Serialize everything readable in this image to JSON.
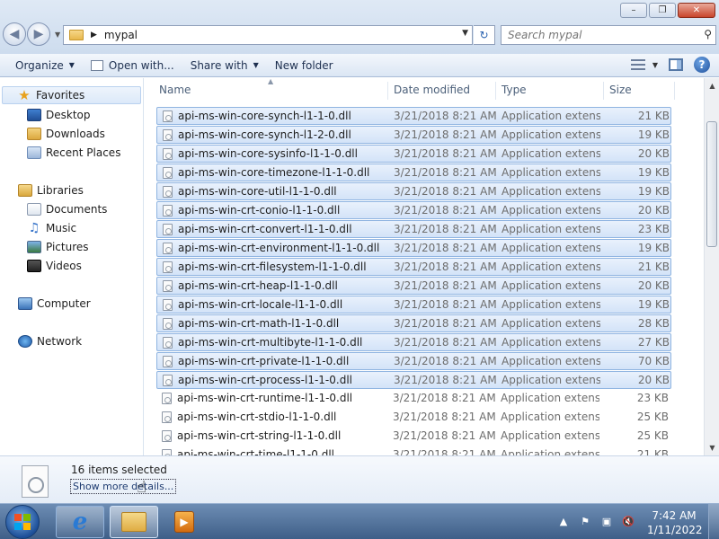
{
  "window": {
    "controls": {
      "minimize": "–",
      "maximize": "❐",
      "close": "✕"
    }
  },
  "address": {
    "path": "mypal",
    "search_placeholder": "Search mypal"
  },
  "toolbar": {
    "organize": "Organize",
    "open_with": "Open with...",
    "share_with": "Share with",
    "new_folder": "New folder"
  },
  "navpane": {
    "favorites": "Favorites",
    "desktop": "Desktop",
    "downloads": "Downloads",
    "recent_places": "Recent Places",
    "libraries": "Libraries",
    "documents": "Documents",
    "music": "Music",
    "pictures": "Pictures",
    "videos": "Videos",
    "computer": "Computer",
    "network": "Network"
  },
  "columns": {
    "name": "Name",
    "date": "Date modified",
    "type": "Type",
    "size": "Size"
  },
  "files": [
    {
      "name": "api-ms-win-core-synch-l1-1-0.dll",
      "date": "3/21/2018 8:21 AM",
      "type": "Application extens...",
      "size": "21 KB",
      "selected": true
    },
    {
      "name": "api-ms-win-core-synch-l1-2-0.dll",
      "date": "3/21/2018 8:21 AM",
      "type": "Application extens...",
      "size": "19 KB",
      "selected": true
    },
    {
      "name": "api-ms-win-core-sysinfo-l1-1-0.dll",
      "date": "3/21/2018 8:21 AM",
      "type": "Application extens...",
      "size": "20 KB",
      "selected": true
    },
    {
      "name": "api-ms-win-core-timezone-l1-1-0.dll",
      "date": "3/21/2018 8:21 AM",
      "type": "Application extens...",
      "size": "19 KB",
      "selected": true
    },
    {
      "name": "api-ms-win-core-util-l1-1-0.dll",
      "date": "3/21/2018 8:21 AM",
      "type": "Application extens...",
      "size": "19 KB",
      "selected": true
    },
    {
      "name": "api-ms-win-crt-conio-l1-1-0.dll",
      "date": "3/21/2018 8:21 AM",
      "type": "Application extens...",
      "size": "20 KB",
      "selected": true
    },
    {
      "name": "api-ms-win-crt-convert-l1-1-0.dll",
      "date": "3/21/2018 8:21 AM",
      "type": "Application extens...",
      "size": "23 KB",
      "selected": true
    },
    {
      "name": "api-ms-win-crt-environment-l1-1-0.dll",
      "date": "3/21/2018 8:21 AM",
      "type": "Application extens...",
      "size": "19 KB",
      "selected": true
    },
    {
      "name": "api-ms-win-crt-filesystem-l1-1-0.dll",
      "date": "3/21/2018 8:21 AM",
      "type": "Application extens...",
      "size": "21 KB",
      "selected": true
    },
    {
      "name": "api-ms-win-crt-heap-l1-1-0.dll",
      "date": "3/21/2018 8:21 AM",
      "type": "Application extens...",
      "size": "20 KB",
      "selected": true
    },
    {
      "name": "api-ms-win-crt-locale-l1-1-0.dll",
      "date": "3/21/2018 8:21 AM",
      "type": "Application extens...",
      "size": "19 KB",
      "selected": true
    },
    {
      "name": "api-ms-win-crt-math-l1-1-0.dll",
      "date": "3/21/2018 8:21 AM",
      "type": "Application extens...",
      "size": "28 KB",
      "selected": true
    },
    {
      "name": "api-ms-win-crt-multibyte-l1-1-0.dll",
      "date": "3/21/2018 8:21 AM",
      "type": "Application extens...",
      "size": "27 KB",
      "selected": true
    },
    {
      "name": "api-ms-win-crt-private-l1-1-0.dll",
      "date": "3/21/2018 8:21 AM",
      "type": "Application extens...",
      "size": "70 KB",
      "selected": true
    },
    {
      "name": "api-ms-win-crt-process-l1-1-0.dll",
      "date": "3/21/2018 8:21 AM",
      "type": "Application extens...",
      "size": "20 KB",
      "selected": true
    },
    {
      "name": "api-ms-win-crt-runtime-l1-1-0.dll",
      "date": "3/21/2018 8:21 AM",
      "type": "Application extens...",
      "size": "23 KB",
      "selected": false
    },
    {
      "name": "api-ms-win-crt-stdio-l1-1-0.dll",
      "date": "3/21/2018 8:21 AM",
      "type": "Application extens...",
      "size": "25 KB",
      "selected": false
    },
    {
      "name": "api-ms-win-crt-string-l1-1-0.dll",
      "date": "3/21/2018 8:21 AM",
      "type": "Application extens...",
      "size": "25 KB",
      "selected": false
    },
    {
      "name": "api-ms-win-crt-time-l1-1-0.dll",
      "date": "3/21/2018 8:21 AM",
      "type": "Application extens...",
      "size": "21 KB",
      "selected": false
    }
  ],
  "details": {
    "summary": "16 items selected",
    "more_link": "Show more details..."
  },
  "taskbar": {
    "time": "7:42 AM",
    "date": "1/11/2022",
    "apps": [
      "internet-explorer-icon",
      "windows-explorer-icon",
      "media-player-icon"
    ]
  },
  "colors": {
    "selection_bg": "#d3e3f8",
    "selection_border": "#8fb4e1",
    "taskbar": "#4f6f98"
  }
}
